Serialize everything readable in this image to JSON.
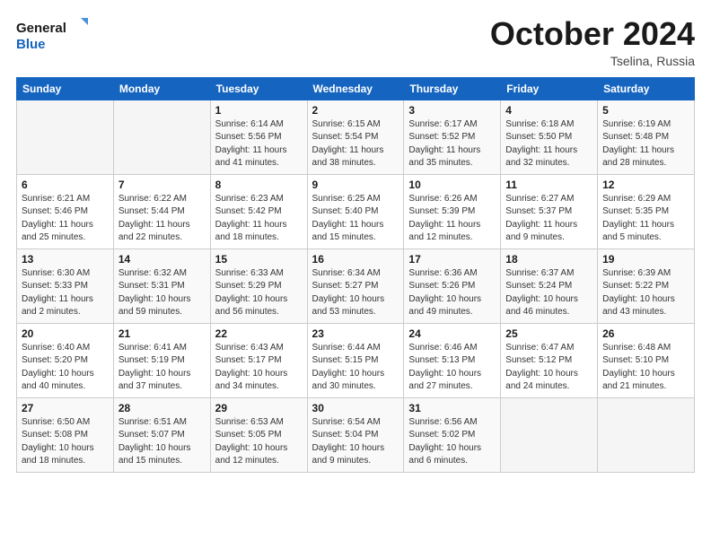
{
  "logo": {
    "line1": "General",
    "line2": "Blue"
  },
  "header": {
    "month": "October 2024",
    "location": "Tselina, Russia"
  },
  "weekdays": [
    "Sunday",
    "Monday",
    "Tuesday",
    "Wednesday",
    "Thursday",
    "Friday",
    "Saturday"
  ],
  "weeks": [
    [
      null,
      null,
      {
        "day": "1",
        "sunrise": "Sunrise: 6:14 AM",
        "sunset": "Sunset: 5:56 PM",
        "daylight": "Daylight: 11 hours and 41 minutes."
      },
      {
        "day": "2",
        "sunrise": "Sunrise: 6:15 AM",
        "sunset": "Sunset: 5:54 PM",
        "daylight": "Daylight: 11 hours and 38 minutes."
      },
      {
        "day": "3",
        "sunrise": "Sunrise: 6:17 AM",
        "sunset": "Sunset: 5:52 PM",
        "daylight": "Daylight: 11 hours and 35 minutes."
      },
      {
        "day": "4",
        "sunrise": "Sunrise: 6:18 AM",
        "sunset": "Sunset: 5:50 PM",
        "daylight": "Daylight: 11 hours and 32 minutes."
      },
      {
        "day": "5",
        "sunrise": "Sunrise: 6:19 AM",
        "sunset": "Sunset: 5:48 PM",
        "daylight": "Daylight: 11 hours and 28 minutes."
      }
    ],
    [
      {
        "day": "6",
        "sunrise": "Sunrise: 6:21 AM",
        "sunset": "Sunset: 5:46 PM",
        "daylight": "Daylight: 11 hours and 25 minutes."
      },
      {
        "day": "7",
        "sunrise": "Sunrise: 6:22 AM",
        "sunset": "Sunset: 5:44 PM",
        "daylight": "Daylight: 11 hours and 22 minutes."
      },
      {
        "day": "8",
        "sunrise": "Sunrise: 6:23 AM",
        "sunset": "Sunset: 5:42 PM",
        "daylight": "Daylight: 11 hours and 18 minutes."
      },
      {
        "day": "9",
        "sunrise": "Sunrise: 6:25 AM",
        "sunset": "Sunset: 5:40 PM",
        "daylight": "Daylight: 11 hours and 15 minutes."
      },
      {
        "day": "10",
        "sunrise": "Sunrise: 6:26 AM",
        "sunset": "Sunset: 5:39 PM",
        "daylight": "Daylight: 11 hours and 12 minutes."
      },
      {
        "day": "11",
        "sunrise": "Sunrise: 6:27 AM",
        "sunset": "Sunset: 5:37 PM",
        "daylight": "Daylight: 11 hours and 9 minutes."
      },
      {
        "day": "12",
        "sunrise": "Sunrise: 6:29 AM",
        "sunset": "Sunset: 5:35 PM",
        "daylight": "Daylight: 11 hours and 5 minutes."
      }
    ],
    [
      {
        "day": "13",
        "sunrise": "Sunrise: 6:30 AM",
        "sunset": "Sunset: 5:33 PM",
        "daylight": "Daylight: 11 hours and 2 minutes."
      },
      {
        "day": "14",
        "sunrise": "Sunrise: 6:32 AM",
        "sunset": "Sunset: 5:31 PM",
        "daylight": "Daylight: 10 hours and 59 minutes."
      },
      {
        "day": "15",
        "sunrise": "Sunrise: 6:33 AM",
        "sunset": "Sunset: 5:29 PM",
        "daylight": "Daylight: 10 hours and 56 minutes."
      },
      {
        "day": "16",
        "sunrise": "Sunrise: 6:34 AM",
        "sunset": "Sunset: 5:27 PM",
        "daylight": "Daylight: 10 hours and 53 minutes."
      },
      {
        "day": "17",
        "sunrise": "Sunrise: 6:36 AM",
        "sunset": "Sunset: 5:26 PM",
        "daylight": "Daylight: 10 hours and 49 minutes."
      },
      {
        "day": "18",
        "sunrise": "Sunrise: 6:37 AM",
        "sunset": "Sunset: 5:24 PM",
        "daylight": "Daylight: 10 hours and 46 minutes."
      },
      {
        "day": "19",
        "sunrise": "Sunrise: 6:39 AM",
        "sunset": "Sunset: 5:22 PM",
        "daylight": "Daylight: 10 hours and 43 minutes."
      }
    ],
    [
      {
        "day": "20",
        "sunrise": "Sunrise: 6:40 AM",
        "sunset": "Sunset: 5:20 PM",
        "daylight": "Daylight: 10 hours and 40 minutes."
      },
      {
        "day": "21",
        "sunrise": "Sunrise: 6:41 AM",
        "sunset": "Sunset: 5:19 PM",
        "daylight": "Daylight: 10 hours and 37 minutes."
      },
      {
        "day": "22",
        "sunrise": "Sunrise: 6:43 AM",
        "sunset": "Sunset: 5:17 PM",
        "daylight": "Daylight: 10 hours and 34 minutes."
      },
      {
        "day": "23",
        "sunrise": "Sunrise: 6:44 AM",
        "sunset": "Sunset: 5:15 PM",
        "daylight": "Daylight: 10 hours and 30 minutes."
      },
      {
        "day": "24",
        "sunrise": "Sunrise: 6:46 AM",
        "sunset": "Sunset: 5:13 PM",
        "daylight": "Daylight: 10 hours and 27 minutes."
      },
      {
        "day": "25",
        "sunrise": "Sunrise: 6:47 AM",
        "sunset": "Sunset: 5:12 PM",
        "daylight": "Daylight: 10 hours and 24 minutes."
      },
      {
        "day": "26",
        "sunrise": "Sunrise: 6:48 AM",
        "sunset": "Sunset: 5:10 PM",
        "daylight": "Daylight: 10 hours and 21 minutes."
      }
    ],
    [
      {
        "day": "27",
        "sunrise": "Sunrise: 6:50 AM",
        "sunset": "Sunset: 5:08 PM",
        "daylight": "Daylight: 10 hours and 18 minutes."
      },
      {
        "day": "28",
        "sunrise": "Sunrise: 6:51 AM",
        "sunset": "Sunset: 5:07 PM",
        "daylight": "Daylight: 10 hours and 15 minutes."
      },
      {
        "day": "29",
        "sunrise": "Sunrise: 6:53 AM",
        "sunset": "Sunset: 5:05 PM",
        "daylight": "Daylight: 10 hours and 12 minutes."
      },
      {
        "day": "30",
        "sunrise": "Sunrise: 6:54 AM",
        "sunset": "Sunset: 5:04 PM",
        "daylight": "Daylight: 10 hours and 9 minutes."
      },
      {
        "day": "31",
        "sunrise": "Sunrise: 6:56 AM",
        "sunset": "Sunset: 5:02 PM",
        "daylight": "Daylight: 10 hours and 6 minutes."
      },
      null,
      null
    ]
  ]
}
